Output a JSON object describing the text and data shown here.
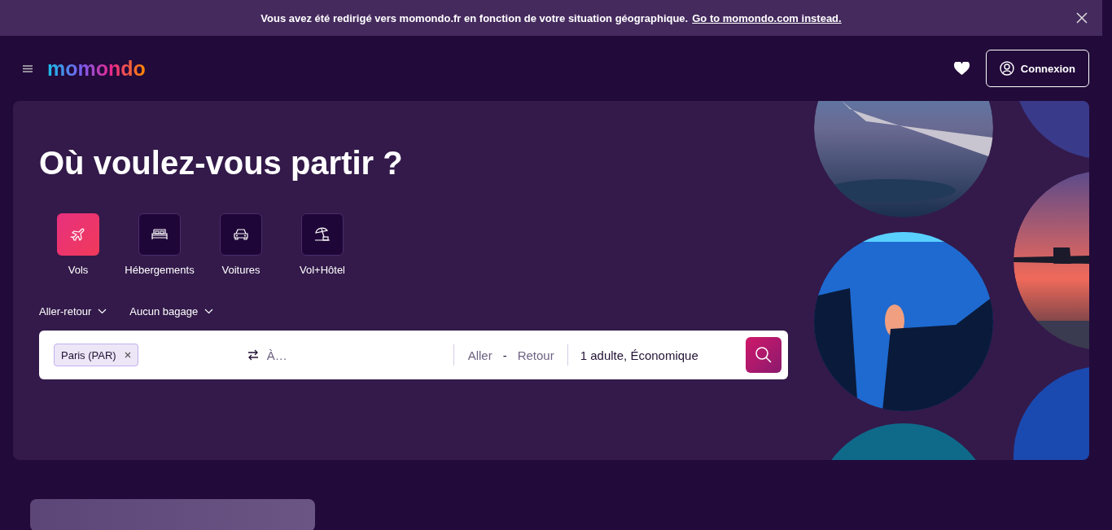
{
  "banner": {
    "message": "Vous avez été redirigé vers momondo.fr en fonction de votre situation géographique.",
    "link": "Go to momondo.com instead."
  },
  "header": {
    "logo": "momondo",
    "login": "Connexion"
  },
  "hero": {
    "title": "Où voulez-vous partir ?",
    "tabs": [
      {
        "label": "Vols",
        "kind": "plane",
        "selected": true
      },
      {
        "label": "Hébergements",
        "kind": "bed",
        "selected": false
      },
      {
        "label": "Voitures",
        "kind": "car",
        "selected": false
      },
      {
        "label": "Vol+Hôtel",
        "kind": "beach",
        "selected": false
      }
    ],
    "options": [
      "Aller-retour",
      "Aucun bagage"
    ],
    "search": {
      "origin": "Paris (PAR)",
      "destination_placeholder": "À…",
      "depart_placeholder": "Aller",
      "dash": "-",
      "return_placeholder": "Retour",
      "travelers": "1 adulte, Économique"
    }
  }
}
